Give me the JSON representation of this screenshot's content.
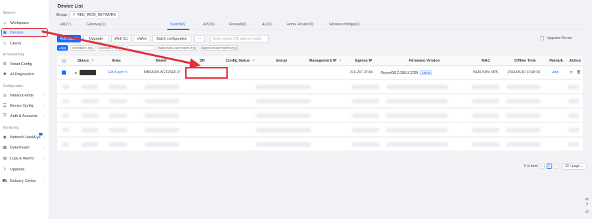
{
  "sidebar": {
    "sections": [
      {
        "label": "Network",
        "items": [
          {
            "label": "Workspace",
            "icon": "workspace-icon"
          },
          {
            "label": "Devices",
            "icon": "devices-icon",
            "active": true
          },
          {
            "label": "Clients",
            "icon": "clients-icon"
          }
        ]
      },
      {
        "label": "AI Networking",
        "items": [
          {
            "label": "Smart Config",
            "icon": "smart-config-icon"
          },
          {
            "label": "AI Diagnostics",
            "icon": "diagnostics-icon"
          }
        ]
      },
      {
        "label": "Configuration",
        "items": [
          {
            "label": "Network-Wide",
            "icon": "network-wide-icon"
          },
          {
            "label": "Device Config",
            "icon": "device-config-icon"
          },
          {
            "label": "Auth & Accounts",
            "icon": "auth-icon"
          }
        ]
      },
      {
        "label": "Monitoring",
        "items": [
          {
            "label": "Network HawkEye",
            "icon": "hawkeye-icon"
          },
          {
            "label": "Data-Board",
            "icon": "data-board-icon"
          },
          {
            "label": "Logs & Alarms",
            "icon": "logs-icon"
          },
          {
            "label": "Upgrade",
            "icon": "upgrade-icon"
          },
          {
            "label": "Delivery Center",
            "icon": "delivery-icon"
          }
        ]
      }
    ]
  },
  "page": {
    "title": "Device List",
    "group_label": "Group",
    "group_value": "RED_IRON_NETWORK"
  },
  "tabs": [
    "All(27)",
    "Gateway(1)",
    "Switch(6)",
    "AP(20)",
    "Firewall(0)",
    "AC(0)",
    "Home Router(0)",
    "Wireless Bridge(0)"
  ],
  "active_tab": 2,
  "toolbar": {
    "add_switch": "Add Switch",
    "upgrade": "Upgrade",
    "web_cli": "Web CLI",
    "eweb": "eWeb",
    "batch_config": "Batch configuration",
    "more": "···",
    "search_placeholder": "Enter device SN, alias or model",
    "upgrade_device": "Upgrade Device"
  },
  "model_chips": [
    "All(6)",
    "ES209GC-P(1)",
    "ES210GC-LP(1)",
    "",
    "NBS3100-24GT4SFP-P(2)",
    "NBS3100-8GT2SFP-P(1)"
  ],
  "table": {
    "headers": {
      "status": "Status",
      "alias": "Alias",
      "model": "Model",
      "sn": "SN",
      "config_status": "Config Status",
      "group": "Group",
      "mgmt_ip": "Management IP",
      "egress_ip": "Egress IP",
      "firmware": "Firmware Version",
      "mac": "MAC",
      "offline_time": "Offline Time",
      "remark": "Remark",
      "action": "Action"
    },
    "first_row": {
      "alias": "Ext.8-port",
      "model": "NBS3100-8GT2SFP-P",
      "egress_ip": "216.247.27.84",
      "firmware": "ReyeeOS 2.280.0.1709",
      "firmware_badge": "Latest",
      "mac": "5416.515c.1f25",
      "offline_time": "2024/06/10 11:40:15",
      "remark": "Add"
    }
  },
  "pagination": {
    "total": "6 in total",
    "current": "1",
    "page_size": "10 / page"
  },
  "colors": {
    "accent": "#1a6dff",
    "annotation": "#e0303a",
    "online": "#52c41a"
  }
}
